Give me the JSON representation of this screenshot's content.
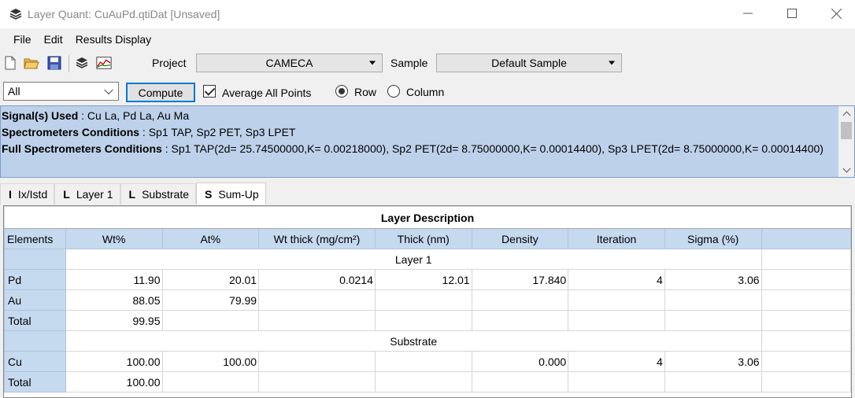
{
  "window": {
    "title": "Layer Quant: CuAuPd.qtiDat [Unsaved]"
  },
  "menu": [
    "File",
    "Edit",
    "Results Display"
  ],
  "toolbar": {
    "icons": [
      "new-file-icon",
      "open-folder-icon",
      "save-icon",
      "layers-icon",
      "chart-icon"
    ],
    "project_label": "Project",
    "project_value": "CAMECA",
    "sample_label": "Sample",
    "sample_value": "Default Sample"
  },
  "controls": {
    "filter_value": "All",
    "compute_label": "Compute",
    "average_label": "Average All Points",
    "average_checked": true,
    "row_label": "Row",
    "column_label": "Column",
    "selected_orientation": "Row"
  },
  "info": {
    "signals_label": "Signal(s) Used",
    "signals_value": " : Cu La, Pd La, Au Ma",
    "spectro_label": "Spectrometers Conditions",
    "spectro_value": " :  Sp1 TAP,  Sp2 PET,  Sp3 LPET",
    "full_label": "Full Spectrometers Conditions",
    "full_value": " :  Sp1 TAP(2d= 25.74500000,K= 0.00218000),  Sp2 PET(2d= 8.75000000,K= 0.00014400),  Sp3 LPET(2d= 8.75000000,K= 0.00014400)"
  },
  "tabs": [
    {
      "icon": "I",
      "label": "Ix/Istd"
    },
    {
      "icon": "L",
      "label": "Layer 1"
    },
    {
      "icon": "L",
      "label": "Substrate"
    },
    {
      "icon": "S",
      "label": "Sum-Up",
      "active": true
    }
  ],
  "table": {
    "title": "Layer Description",
    "columns": [
      "Elements",
      "Wt%",
      "At%",
      "Wt thick (mg/cm²)",
      "Thick (nm)",
      "Density",
      "Iteration",
      "Sigma (%)"
    ],
    "sections": [
      {
        "name": "Layer 1",
        "rows": [
          [
            "Pd",
            "11.90",
            "20.01",
            "0.0214",
            "12.01",
            "17.840",
            "4",
            "3.06"
          ],
          [
            "Au",
            "88.05",
            "79.99",
            "",
            "",
            "",
            "",
            ""
          ],
          [
            "Total",
            "99.95",
            "",
            "",
            "",
            "",
            "",
            ""
          ]
        ]
      },
      {
        "name": "Substrate",
        "rows": [
          [
            "Cu",
            "100.00",
            "100.00",
            "",
            "",
            "0.000",
            "4",
            "3.06"
          ],
          [
            "Total",
            "100.00",
            "",
            "",
            "",
            "",
            "",
            ""
          ]
        ]
      }
    ]
  }
}
